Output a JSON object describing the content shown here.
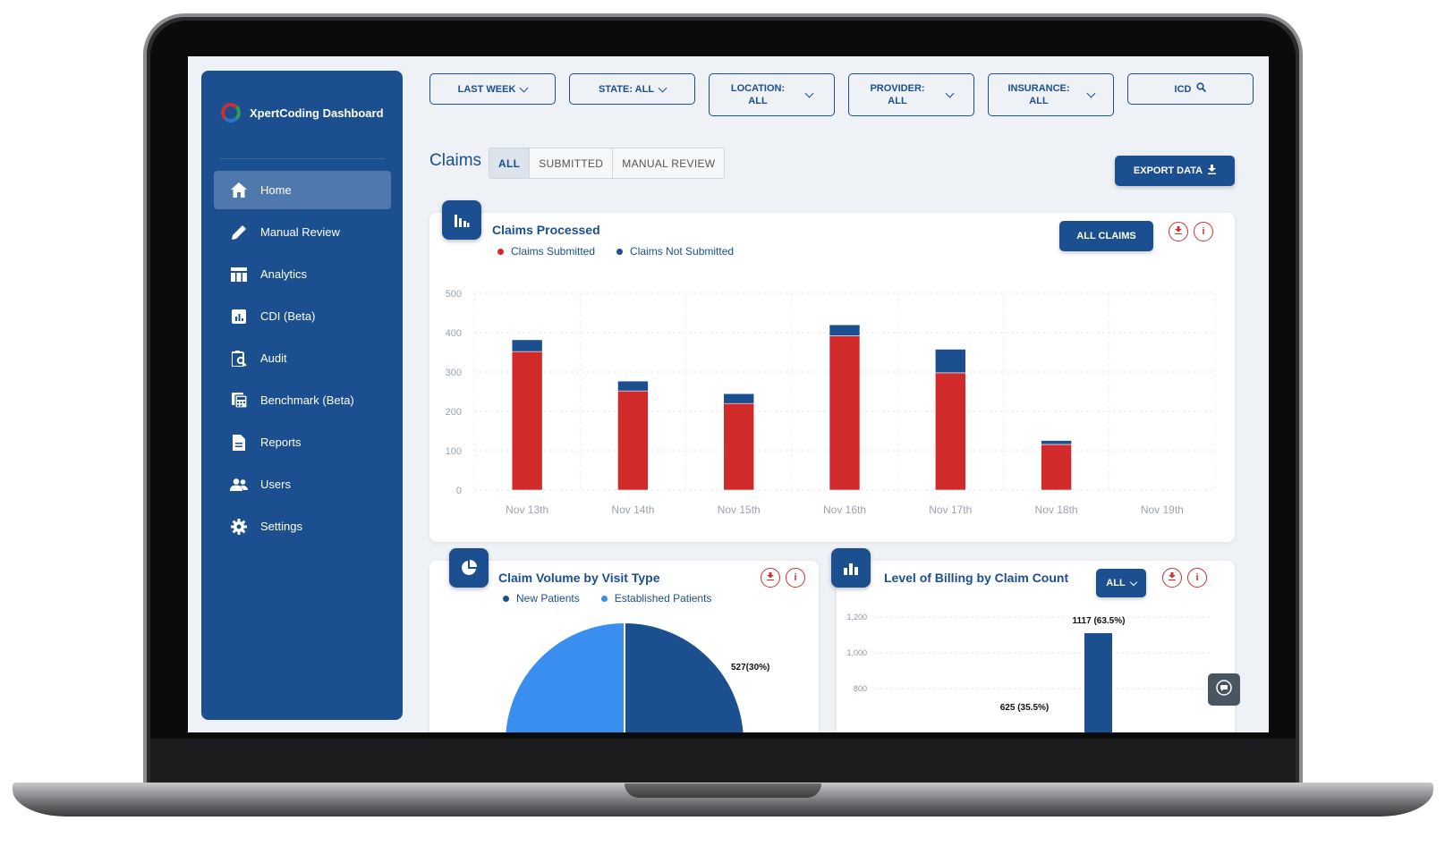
{
  "app": {
    "brand": "XpertCoding Dashboard"
  },
  "sidebar": {
    "items": [
      {
        "label": "Home",
        "icon": "home-icon",
        "active": true
      },
      {
        "label": "Manual Review",
        "icon": "pencil-icon"
      },
      {
        "label": "Analytics",
        "icon": "table-icon"
      },
      {
        "label": "CDI (Beta)",
        "icon": "chart-box-icon"
      },
      {
        "label": "Audit",
        "icon": "clipboard-search-icon"
      },
      {
        "label": "Benchmark (Beta)",
        "icon": "calculator-icon"
      },
      {
        "label": "Reports",
        "icon": "document-icon"
      },
      {
        "label": "Users",
        "icon": "users-icon"
      },
      {
        "label": "Settings",
        "icon": "gear-icon"
      }
    ]
  },
  "filters": {
    "date": "LAST WEEK",
    "state": "STATE: ALL",
    "location_line1": "LOCATION:",
    "location_line2": "ALL",
    "provider_line1": "PROVIDER:",
    "provider_line2": "ALL",
    "insurance_line1": "INSURANCE:",
    "insurance_line2": "ALL",
    "icd": "ICD"
  },
  "claims": {
    "title": "Claims",
    "tabs": [
      "ALL",
      "SUBMITTED",
      "MANUAL REVIEW"
    ],
    "active_tab": "ALL",
    "export_label": "EXPORT DATA"
  },
  "claims_processed": {
    "title": "Claims Processed",
    "all_claims_label": "ALL CLAIMS",
    "legend": [
      "Claims Submitted",
      "Claims Not Submitted"
    ]
  },
  "visit_type": {
    "title": "Claim Volume by Visit Type",
    "legend": [
      "New Patients",
      "Established Patients"
    ],
    "label_a": "527(30%)"
  },
  "billing_level": {
    "title": "Level of Billing by Claim Count",
    "filter_label": "ALL",
    "yticks": [
      "1,200",
      "1,000",
      "800"
    ],
    "bar_label": "1117 (63.5%)",
    "bar_label_2": "625 (35.5%)"
  },
  "colors": {
    "primary": "#1b4f8f",
    "submitted": "#d12a2a",
    "not_submitted": "#1b4f8f",
    "established": "#3a8ef0"
  },
  "chart_data": [
    {
      "type": "bar",
      "title": "Claims Processed",
      "stacked": true,
      "categories": [
        "Nov 13th",
        "Nov 14th",
        "Nov 15th",
        "Nov 16th",
        "Nov 17th",
        "Nov 18th",
        "Nov 19th"
      ],
      "series": [
        {
          "name": "Claims Submitted",
          "values": [
            352,
            252,
            220,
            392,
            298,
            116,
            0
          ]
        },
        {
          "name": "Claims Not Submitted",
          "values": [
            30,
            25,
            25,
            28,
            60,
            10,
            0
          ]
        }
      ],
      "ylim": [
        0,
        500
      ],
      "yticks": [
        0,
        100,
        200,
        300,
        400,
        500
      ],
      "grid": true,
      "legend": "top-left"
    },
    {
      "type": "pie",
      "title": "Claim Volume by Visit Type",
      "labels": [
        "New Patients",
        "Established Patients"
      ],
      "values": [
        527,
        null
      ],
      "data_labels": [
        "527(30%)"
      ],
      "legend": "top"
    },
    {
      "type": "bar",
      "title": "Level of Billing by Claim Count",
      "values": [
        1117,
        625
      ],
      "data_labels": [
        "1117 (63.5%)",
        "625 (35.5%)"
      ],
      "yticks": [
        800,
        1000,
        1200
      ],
      "grid": true
    }
  ]
}
